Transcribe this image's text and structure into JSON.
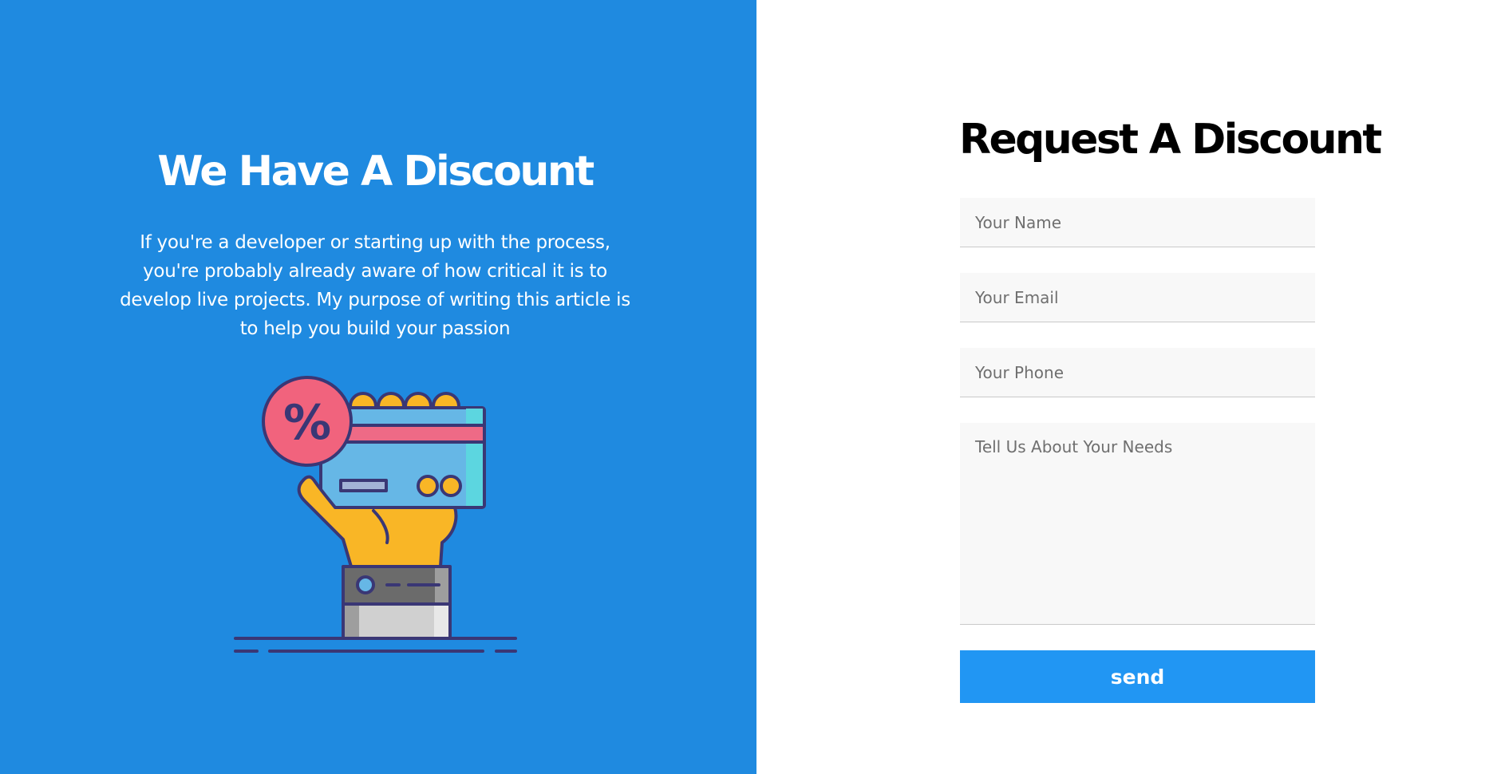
{
  "colors": {
    "left_background": "#1f8ae0",
    "button_background": "#2196f3",
    "field_background": "#f8f8f8"
  },
  "promo": {
    "title": "We Have A Discount",
    "description": "If you're a developer or starting up with the process, you're probably already aware of how critical it is to develop live projects. My purpose of writing this article is to help you build your passion",
    "illustration": "hand-holding-credit-card-with-percent-badge"
  },
  "form": {
    "title": "Request A Discount",
    "name_placeholder": "Your Name",
    "email_placeholder": "Your Email",
    "phone_placeholder": "Your Phone",
    "needs_placeholder": "Tell Us About Your Needs",
    "send_label": "send"
  }
}
